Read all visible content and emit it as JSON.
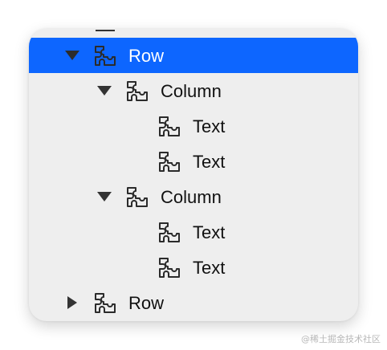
{
  "tree": {
    "items": [
      {
        "label": "Row",
        "icon": "puzzle-icon",
        "expander": "expanded",
        "selected": true
      },
      {
        "label": "Column",
        "icon": "puzzle-icon",
        "expander": "expanded",
        "selected": false
      },
      {
        "label": "Text",
        "icon": "puzzle-icon",
        "expander": "none",
        "selected": false
      },
      {
        "label": "Text",
        "icon": "puzzle-icon",
        "expander": "none",
        "selected": false
      },
      {
        "label": "Column",
        "icon": "puzzle-icon",
        "expander": "expanded",
        "selected": false
      },
      {
        "label": "Text",
        "icon": "puzzle-icon",
        "expander": "none",
        "selected": false
      },
      {
        "label": "Text",
        "icon": "puzzle-icon",
        "expander": "none",
        "selected": false
      },
      {
        "label": "Row",
        "icon": "puzzle-icon",
        "expander": "collapsed",
        "selected": false
      }
    ]
  },
  "colors": {
    "selection": "#0d66ff",
    "panel": "#eeeeee"
  },
  "watermark": "@稀土掘金技术社区"
}
